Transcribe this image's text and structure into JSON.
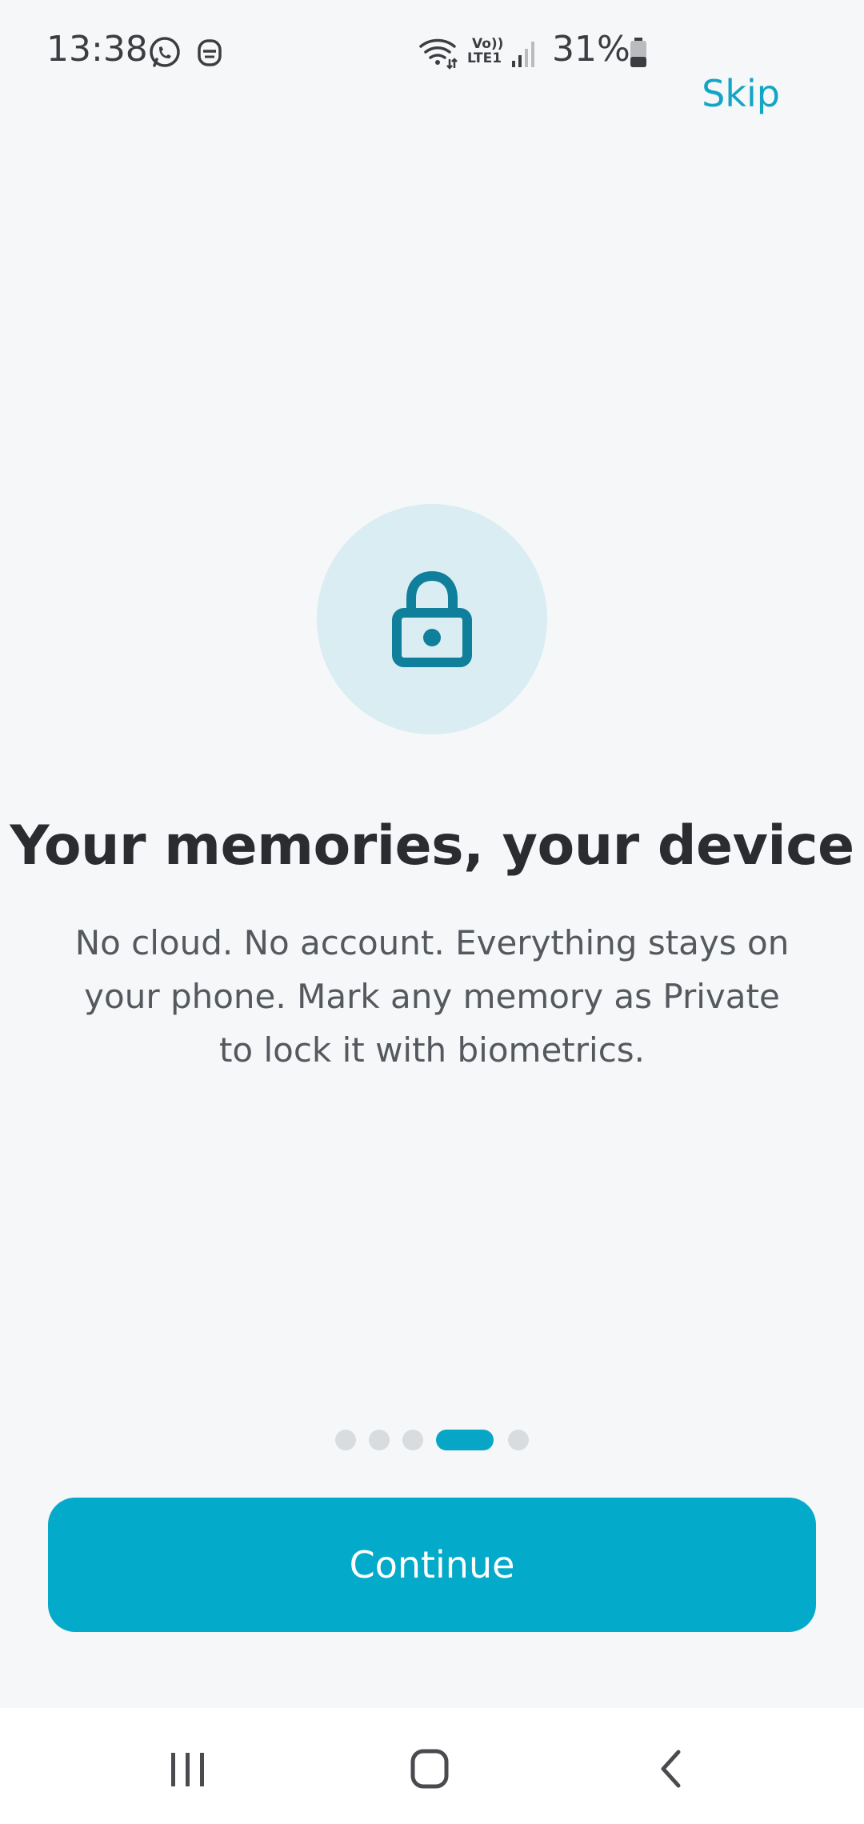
{
  "status_bar": {
    "time": "13:38",
    "battery_percent": "31%",
    "icons": [
      "whatsapp-icon",
      "app-notification-icon",
      "wifi-icon",
      "volte-lte-icon",
      "signal-icon",
      "battery-icon"
    ],
    "volte_label_top": "Vo))",
    "volte_label_bottom": "LTE1"
  },
  "header": {
    "skip_label": "Skip"
  },
  "onboarding": {
    "icon": "lock-icon",
    "title": "Your memories, your device",
    "description": "No cloud. No account. Everything stays on your phone. Mark any memory as Private to lock it with biometrics.",
    "page_count": 5,
    "active_page": 4
  },
  "actions": {
    "continue_label": "Continue"
  },
  "navigation": {
    "buttons": [
      "recents-icon",
      "home-icon",
      "back-icon"
    ]
  },
  "colors": {
    "accent": "#04aac9",
    "skip_text": "#14a5c4",
    "icon_circle": "#d9edf2",
    "lock_icon": "#0f7f9b",
    "background": "#f5f7f9"
  }
}
